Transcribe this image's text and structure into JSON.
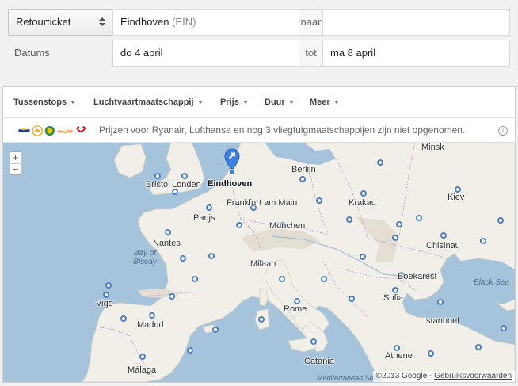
{
  "form": {
    "trip_type": "Retourticket",
    "origin": "Eindhoven",
    "origin_code": "(EIN)",
    "to_label": "naar",
    "destination": "",
    "dates_label": "Datums",
    "depart": "do 4 april",
    "until_label": "tot",
    "return": "ma 8 april"
  },
  "filters": [
    "Tussenstops",
    "Luchtvaartmaatschappij",
    "Prijs",
    "Duur",
    "Meer"
  ],
  "notice": {
    "text": "Prijzen voor Ryanair, Lufthansa en nog 3 vliegtuigmaatschappijen zijn niet opgenomen.",
    "info_icon": "info-icon"
  },
  "map": {
    "zoom_in": "+",
    "zoom_out": "−",
    "home_city": "Eindhoven",
    "cities": [
      "Minsk",
      "Berlijn",
      "Bristol",
      "Londen",
      "Frankfurt am Main",
      "Krakau",
      "Kiev",
      "Parijs",
      "München",
      "Nantes",
      "Chisinau",
      "Milaan",
      "Boekarest",
      "Vigo",
      "Sofia",
      "Rome",
      "Madrid",
      "Istanboel",
      "Athene",
      "Málaga",
      "Catania"
    ],
    "seas": [
      "Bay of Biscay",
      "Black Sea",
      "Mediterranean Sea"
    ],
    "copyright": "©2013 Google - ",
    "terms": "Gebruiksvoorwaarden",
    "colors": {
      "water": "#a6c3dc",
      "land": "#f2efe9",
      "marker": "#4d7fc4",
      "pin": "#3b7fe4"
    }
  }
}
